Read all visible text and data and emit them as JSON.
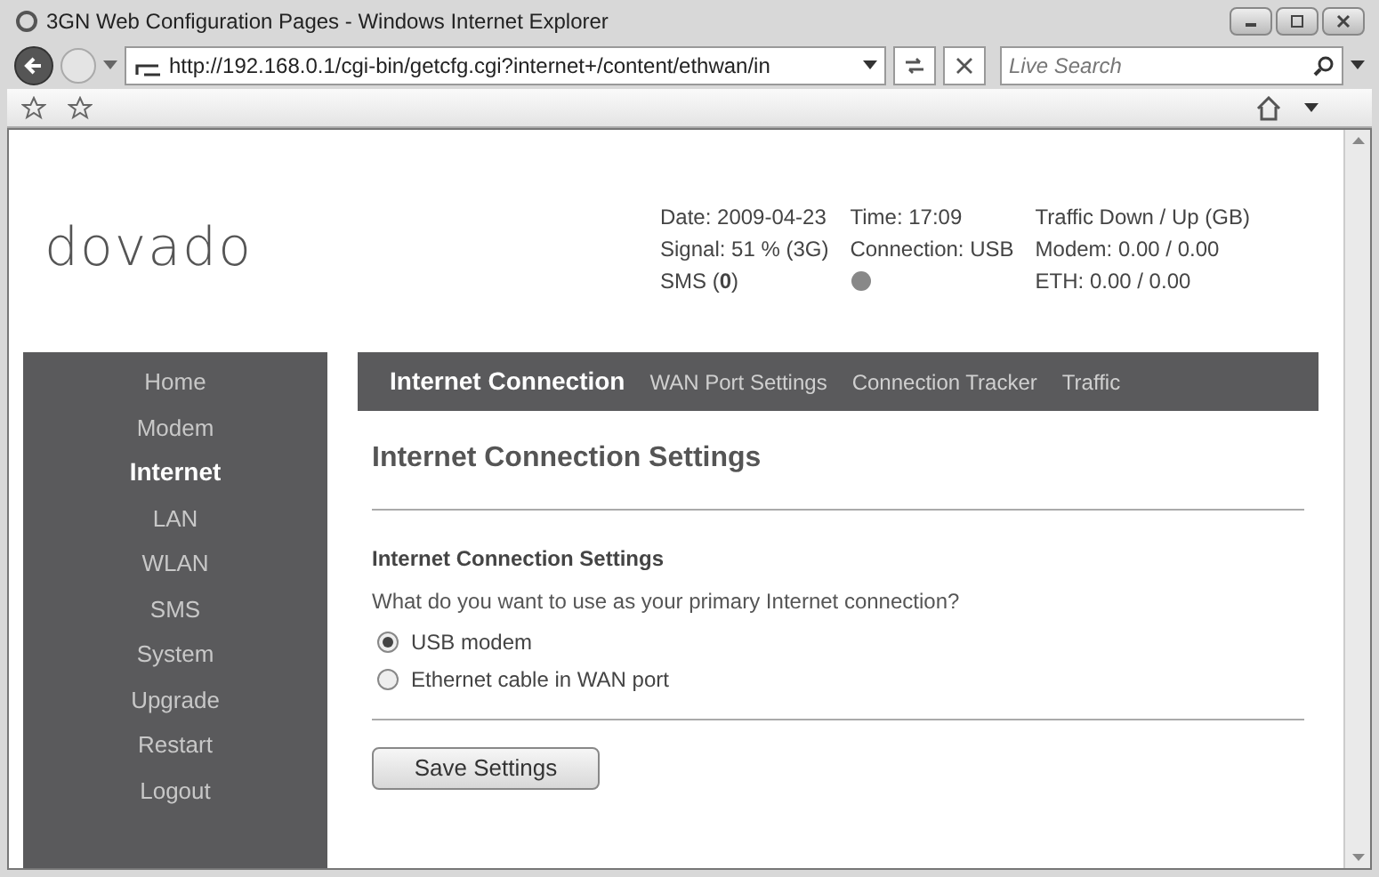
{
  "window": {
    "title": "3GN Web Configuration Pages - Windows Internet Explorer"
  },
  "address_bar": {
    "value": "http://192.168.0.1/cgi-bin/getcfg.cgi?internet+/content/ethwan/in"
  },
  "search": {
    "placeholder": "Live Search"
  },
  "logo": "dovado",
  "status": {
    "date": "Date: 2009-04-23",
    "signal": "Signal: 51 % (3G)",
    "sms": "SMS (**0**)",
    "time": "Time: 17:09",
    "connection": "Connection: USB",
    "traffic_title": "Traffic Down / Up (GB)",
    "modem": "Modem: 0.00 / 0.00",
    "eth": "ETH: 0.00 / 0.00"
  },
  "sidebar": {
    "items": [
      {
        "label": "Home",
        "selected": false
      },
      {
        "label": "Modem",
        "selected": false
      },
      {
        "label": "Internet",
        "selected": true
      },
      {
        "label": "LAN",
        "selected": false
      },
      {
        "label": "WLAN",
        "selected": false
      },
      {
        "label": "SMS",
        "selected": false
      },
      {
        "label": "System",
        "selected": false
      },
      {
        "label": "Upgrade",
        "selected": false
      },
      {
        "label": "Restart",
        "selected": false
      },
      {
        "label": "Logout",
        "selected": false
      }
    ]
  },
  "tabs": [
    {
      "label": "Internet Connection",
      "selected": true
    },
    {
      "label": "WAN Port Settings",
      "selected": false
    },
    {
      "label": "Connection Tracker",
      "selected": false
    },
    {
      "label": "Traffic",
      "selected": false
    }
  ],
  "page_title": "Internet Connection Settings",
  "section": {
    "heading": "Internet Connection Settings",
    "question": "What do you want to use as your primary Internet connection?",
    "options": [
      {
        "label": "USB modem",
        "selected": true
      },
      {
        "label": "Ethernet cable in WAN port",
        "selected": false
      }
    ]
  },
  "save_button": "Save Settings"
}
